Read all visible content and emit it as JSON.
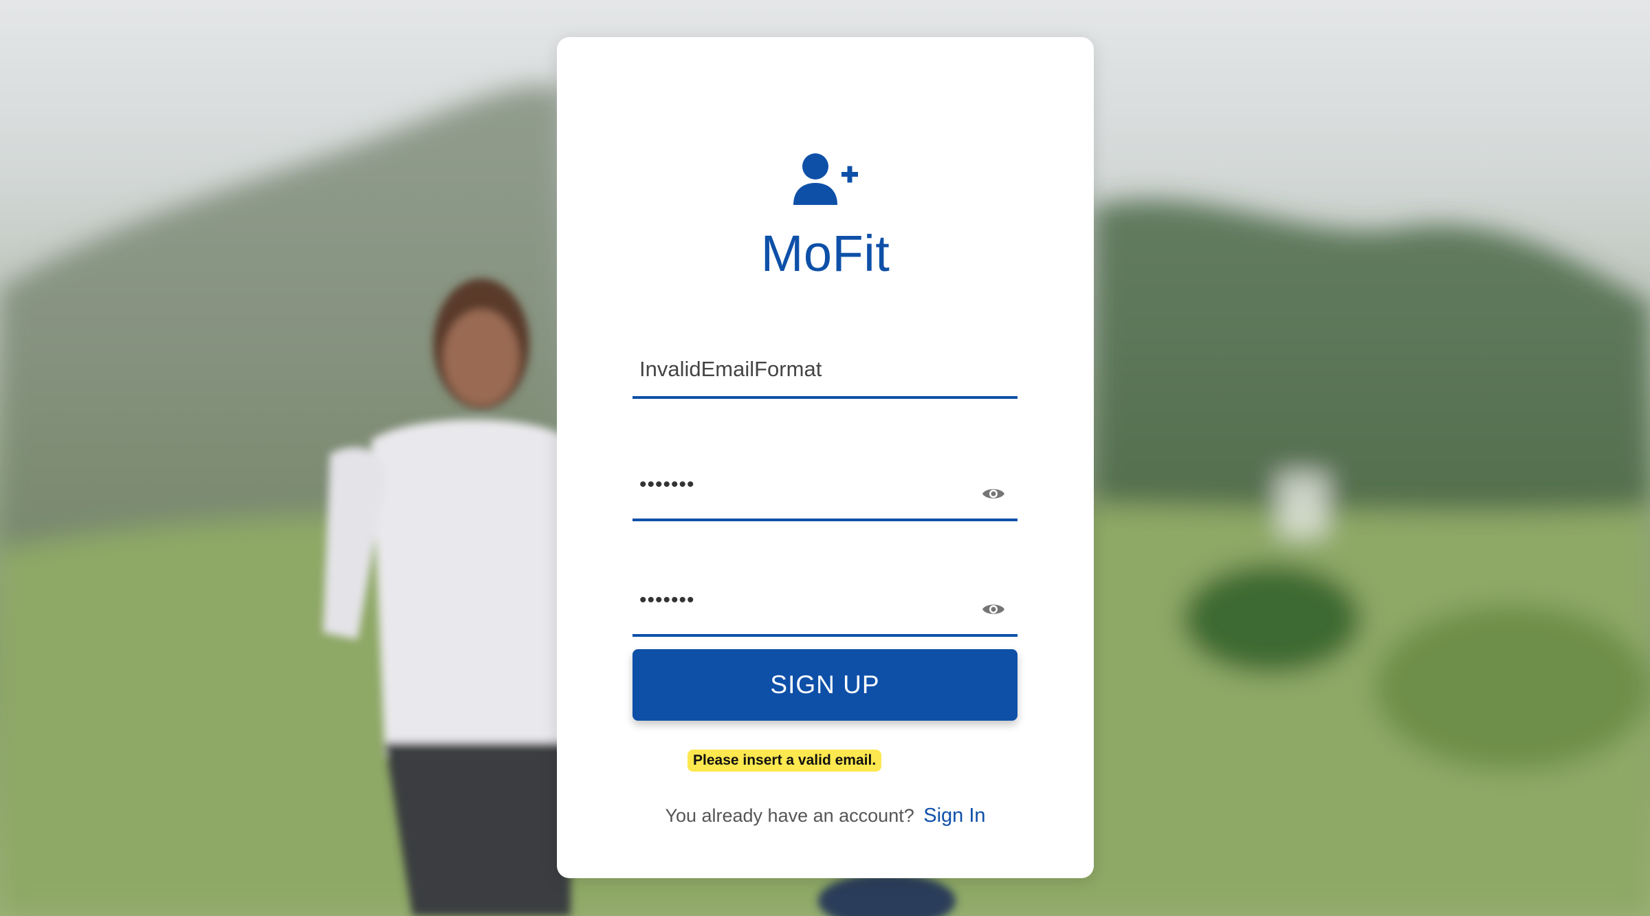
{
  "app": {
    "title": "MoFit",
    "brand_color": "#0e50a8",
    "logo_icon": "user-plus-icon"
  },
  "form": {
    "email_value": "InvalidEmailFormat",
    "password_value": "•••••••",
    "confirm_password_value": "•••••••",
    "password_toggle_icon": "eye-icon",
    "submit_label": "SIGN UP",
    "error_message": "Please insert a valid email.",
    "error_color": "#fde84f"
  },
  "footer": {
    "prompt": "You already have an account?",
    "link_label": "Sign In"
  }
}
